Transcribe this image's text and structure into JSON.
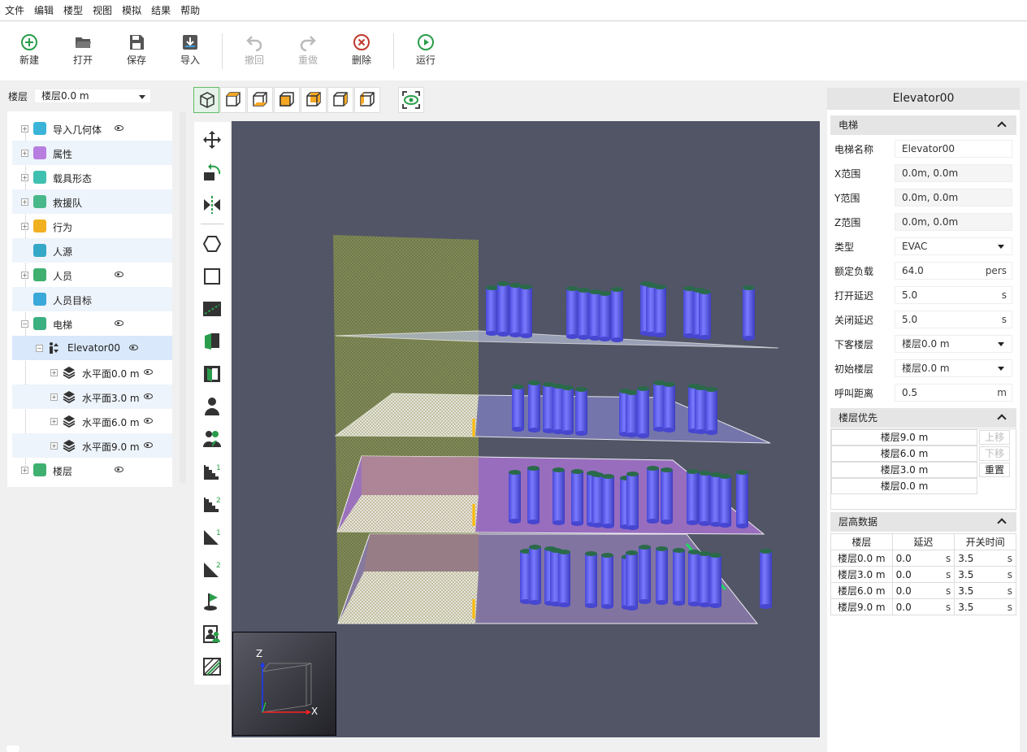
{
  "menu": [
    "文件",
    "编辑",
    "楼型",
    "视图",
    "模拟",
    "结果",
    "帮助"
  ],
  "toolbar": {
    "new": "新建",
    "open": "打开",
    "save": "保存",
    "import": "导入",
    "undo": "撤回",
    "redo": "重做",
    "delete": "删除",
    "run": "运行"
  },
  "floor_selector": {
    "label": "楼层",
    "value": "楼层0.0 m"
  },
  "tree": [
    {
      "label": "导入几何体",
      "eye": true,
      "color": "#3bb4d8"
    },
    {
      "label": "属性",
      "eye": false,
      "color": "#b77ee0"
    },
    {
      "label": "载具形态",
      "eye": false,
      "color": "#40c0b0"
    },
    {
      "label": "救援队",
      "eye": false,
      "color": "#48b88a"
    },
    {
      "label": "行为",
      "eye": false,
      "color": "#f0b020"
    },
    {
      "label": "人源",
      "eye": false,
      "color": "#35a8c8"
    },
    {
      "label": "人员",
      "eye": true,
      "color": "#40b070"
    },
    {
      "label": "人员目标",
      "eye": false,
      "color": "#3aa8d8"
    },
    {
      "label": "电梯",
      "eye": true,
      "color": "#3cb080"
    },
    {
      "label": "Elevator00",
      "eye": true
    },
    {
      "label": "水平面0.0 m",
      "eye": true
    },
    {
      "label": "水平面3.0 m",
      "eye": true
    },
    {
      "label": "水平面6.0 m",
      "eye": true
    },
    {
      "label": "水平面9.0 m",
      "eye": true
    },
    {
      "label": "楼层",
      "eye": true,
      "color": "#40b070"
    }
  ],
  "axes": {
    "z": "Z",
    "x": "X"
  },
  "props": {
    "title": "Elevator00",
    "section_elevator": "电梯",
    "fields": [
      {
        "k": "电梯名称",
        "v": "Elevator00",
        "u": ""
      },
      {
        "k": "X范围",
        "v": "0.0m, 0.0m",
        "u": ""
      },
      {
        "k": "Y范围",
        "v": "0.0m, 0.0m",
        "u": ""
      },
      {
        "k": "Z范围",
        "v": "0.0m, 0.0m",
        "u": ""
      },
      {
        "k": "类型",
        "v": "EVAC",
        "u": ""
      },
      {
        "k": "额定负载",
        "v": "64.0",
        "u": "pers"
      },
      {
        "k": "打开延迟",
        "v": "5.0",
        "u": "s"
      },
      {
        "k": "关闭延迟",
        "v": "5.0",
        "u": "s"
      },
      {
        "k": "下客楼层",
        "v": "楼层0.0 m",
        "u": ""
      },
      {
        "k": "初始楼层",
        "v": "楼层0.0 m",
        "u": ""
      },
      {
        "k": "呼叫距离",
        "v": "0.5",
        "u": "m"
      }
    ],
    "section_priority": "楼层优先",
    "priority": [
      "楼层9.0 m",
      "楼层6.0 m",
      "楼层3.0 m",
      "楼层0.0 m"
    ],
    "move_up": "上移",
    "move_down": "下移",
    "reset": "重置",
    "section_height": "层高数据",
    "height_headers": [
      "楼层",
      "延迟",
      "开关时间"
    ],
    "height_rows": [
      {
        "floor": "楼层0.0 m",
        "delay": "0.0",
        "du": "s",
        "time": "3.5",
        "tu": "s"
      },
      {
        "floor": "楼层3.0 m",
        "delay": "0.0",
        "du": "s",
        "time": "3.5",
        "tu": "s"
      },
      {
        "floor": "楼层6.0 m",
        "delay": "0.0",
        "du": "s",
        "time": "3.5",
        "tu": "s"
      },
      {
        "floor": "楼层9.0 m",
        "delay": "0.0",
        "du": "s",
        "time": "3.5",
        "tu": "s"
      }
    ]
  }
}
